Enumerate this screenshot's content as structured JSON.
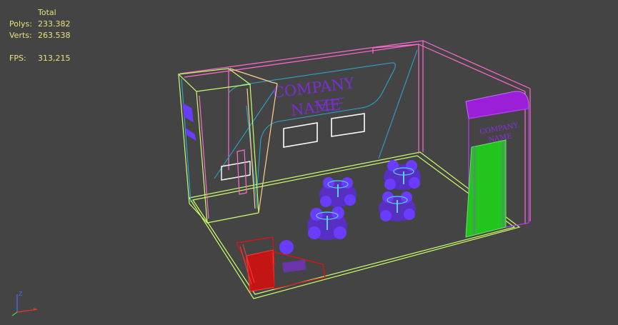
{
  "stats": {
    "header": "Total",
    "polys_label": "Polys:",
    "polys_value": "233.382",
    "verts_label": "Verts:",
    "verts_value": "263.538",
    "fps_label": "FPS:",
    "fps_value": "313,215"
  },
  "scene": {
    "back_wall_text_line1": "COMPANY",
    "back_wall_text_line2": "NAME",
    "pillar_text_line1": "COMPANY",
    "pillar_text_line2": "NAME"
  },
  "gizmo": {
    "z_label": "Z"
  },
  "colors": {
    "background": "#444444",
    "stats_text": "#e8e27a",
    "floor_outline": "#c8ff6a",
    "wall_outline": "#ff6ad0",
    "brand_purple": "#8a2bd0",
    "pillar_green": "#22c41e",
    "reception_red": "#d01818",
    "furniture_blue": "#6a3cff",
    "wire_cyan": "#2aa6c8"
  }
}
